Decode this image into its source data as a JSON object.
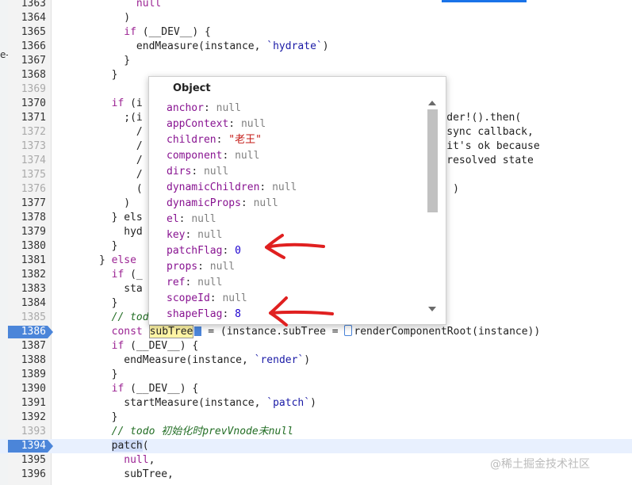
{
  "left_edge_text": "e-",
  "lines": [
    {
      "num": "1363",
      "text": "            null"
    },
    {
      "num": "1364",
      "text": "          )"
    },
    {
      "num": "1365",
      "text": "          if (__DEV__) {"
    },
    {
      "num": "1366",
      "text": "            endMeasure(instance, `hydrate`)"
    },
    {
      "num": "1367",
      "text": "          }"
    },
    {
      "num": "1368",
      "text": "        }"
    },
    {
      "num": "1369",
      "text": ""
    },
    {
      "num": "1370",
      "text": "        if (i"
    },
    {
      "num": "1371",
      "text": "          ;(i                                              Loader!().then("
    },
    {
      "num": "1372",
      "text": "            /                                                async callback,"
    },
    {
      "num": "1373",
      "text": "            /                                              ut it's ok because"
    },
    {
      "num": "1374",
      "text": "            /                                              in resolved state"
    },
    {
      "num": "1375",
      "text": "            /"
    },
    {
      "num": "1376",
      "text": "            (                                                  )"
    },
    {
      "num": "1377",
      "text": "          )"
    },
    {
      "num": "1378",
      "text": "        } els"
    },
    {
      "num": "1379",
      "text": "          hyd"
    },
    {
      "num": "1380",
      "text": "        }"
    },
    {
      "num": "1381",
      "text": "      } else"
    },
    {
      "num": "1382",
      "text": "        if (_"
    },
    {
      "num": "1383",
      "text": "          sta"
    },
    {
      "num": "1384",
      "text": "        }"
    },
    {
      "num": "1385",
      "text": "        // todo subTree 是组件的vnode"
    },
    {
      "num": "1386",
      "text": "const",
      "subtree": "subTree",
      "rest": " = (instance.subTree = ",
      "rest2": "renderComponentRoot(instance))"
    },
    {
      "num": "1387",
      "text": "        if (__DEV__) {"
    },
    {
      "num": "1388",
      "text": "          endMeasure(instance, `render`)"
    },
    {
      "num": "1389",
      "text": "        }"
    },
    {
      "num": "1390",
      "text": "        if (__DEV__) {"
    },
    {
      "num": "1391",
      "text": "          startMeasure(instance, `patch`)"
    },
    {
      "num": "1392",
      "text": "        }"
    },
    {
      "num": "1393",
      "text": "        // todo 初始化时prevVnode未null"
    },
    {
      "num": "1394",
      "text": "patch",
      "after": "("
    },
    {
      "num": "1395",
      "text": "          null,"
    },
    {
      "num": "1396",
      "text": "          subTree,"
    }
  ],
  "popover": {
    "title": "Object",
    "props": [
      {
        "key": "anchor",
        "value": "null",
        "type": "null"
      },
      {
        "key": "appContext",
        "value": "null",
        "type": "null"
      },
      {
        "key": "children",
        "value": "\"老王\"",
        "type": "str"
      },
      {
        "key": "component",
        "value": "null",
        "type": "null"
      },
      {
        "key": "dirs",
        "value": "null",
        "type": "null"
      },
      {
        "key": "dynamicChildren",
        "value": "null",
        "type": "null"
      },
      {
        "key": "dynamicProps",
        "value": "null",
        "type": "null"
      },
      {
        "key": "el",
        "value": "null",
        "type": "null"
      },
      {
        "key": "key",
        "value": "null",
        "type": "null"
      },
      {
        "key": "patchFlag",
        "value": "0",
        "type": "num"
      },
      {
        "key": "props",
        "value": "null",
        "type": "null"
      },
      {
        "key": "ref",
        "value": "null",
        "type": "null"
      },
      {
        "key": "scopeId",
        "value": "null",
        "type": "null"
      },
      {
        "key": "shapeFlag",
        "value": "8",
        "type": "num"
      }
    ]
  },
  "watermark": "@稀土掘金技术社区",
  "colors": {
    "breakpoint": "#4b85d9",
    "annotation_arrow": "#e02020",
    "accent": "#1a73e8"
  }
}
